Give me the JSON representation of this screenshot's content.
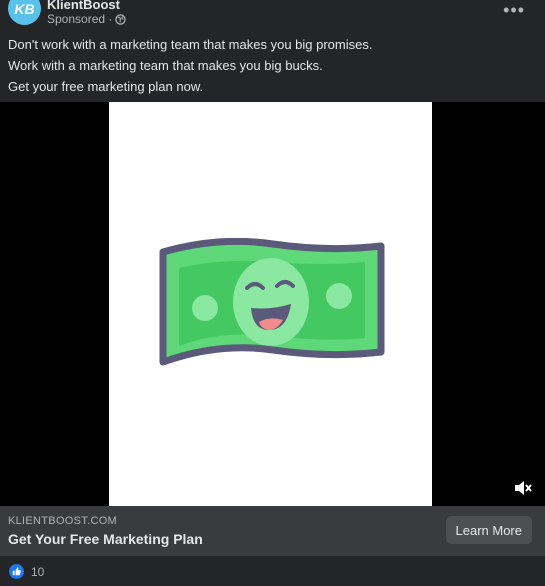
{
  "post": {
    "page_name": "KlientBoost",
    "avatar_text": "KB",
    "sponsored_label": "Sponsored ·",
    "globe_icon": "globe-icon",
    "more_label": "•••",
    "caption_lines": [
      "Don't work with a marketing team that makes you big promises.",
      "Work with a marketing team that makes you big bucks.",
      "Get your free marketing plan now."
    ]
  },
  "media": {
    "image_icon": "smiling-dollar-bill",
    "mute_icon": "muted-speaker-icon"
  },
  "link": {
    "domain": "KLIENTBOOST.COM",
    "title": "Get Your Free Marketing Plan",
    "cta_label": "Learn More"
  },
  "reactions": {
    "like_icon": "like-icon",
    "count": "10"
  },
  "colors": {
    "background": "#242526",
    "avatar": "#58c2ea",
    "like_blue": "#1877f2",
    "bill_green": "#5ed879",
    "bill_outline": "#5b5a7a"
  }
}
